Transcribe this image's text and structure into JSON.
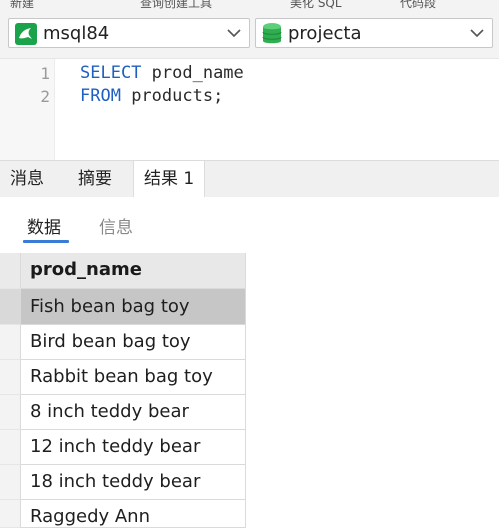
{
  "toolbar_fragments": {
    "frag1": "新建",
    "frag2": "查询创建工具",
    "frag3": "美化 SQL",
    "frag4": "代码段"
  },
  "connection": {
    "name": "msql84",
    "icon": "mysql-dolphin-icon",
    "color": "#1aa34a"
  },
  "database": {
    "name": "projecta",
    "icon": "database-cylinder-icon",
    "color": "#2fae4f"
  },
  "editor": {
    "lines": [
      {
        "number": "1",
        "keyword": "SELECT",
        "rest": " prod_name"
      },
      {
        "number": "2",
        "keyword": "FROM",
        "rest": " products;"
      }
    ],
    "keyword_color": "#1f5fbf"
  },
  "result_tabs": [
    {
      "label": "消息"
    },
    {
      "label": "摘要"
    },
    {
      "label": "结果 1"
    }
  ],
  "sub_tabs": [
    {
      "label": "数据"
    },
    {
      "label": "信息"
    }
  ],
  "accent_color": "#3a7bd5",
  "grid": {
    "column": "prod_name",
    "rows": [
      "Fish bean bag toy",
      "Bird bean bag toy",
      "Rabbit bean bag toy",
      "8 inch teddy bear",
      "12 inch teddy bear",
      "18 inch teddy bear",
      "Raggedy Ann"
    ],
    "selected_row": 0
  }
}
